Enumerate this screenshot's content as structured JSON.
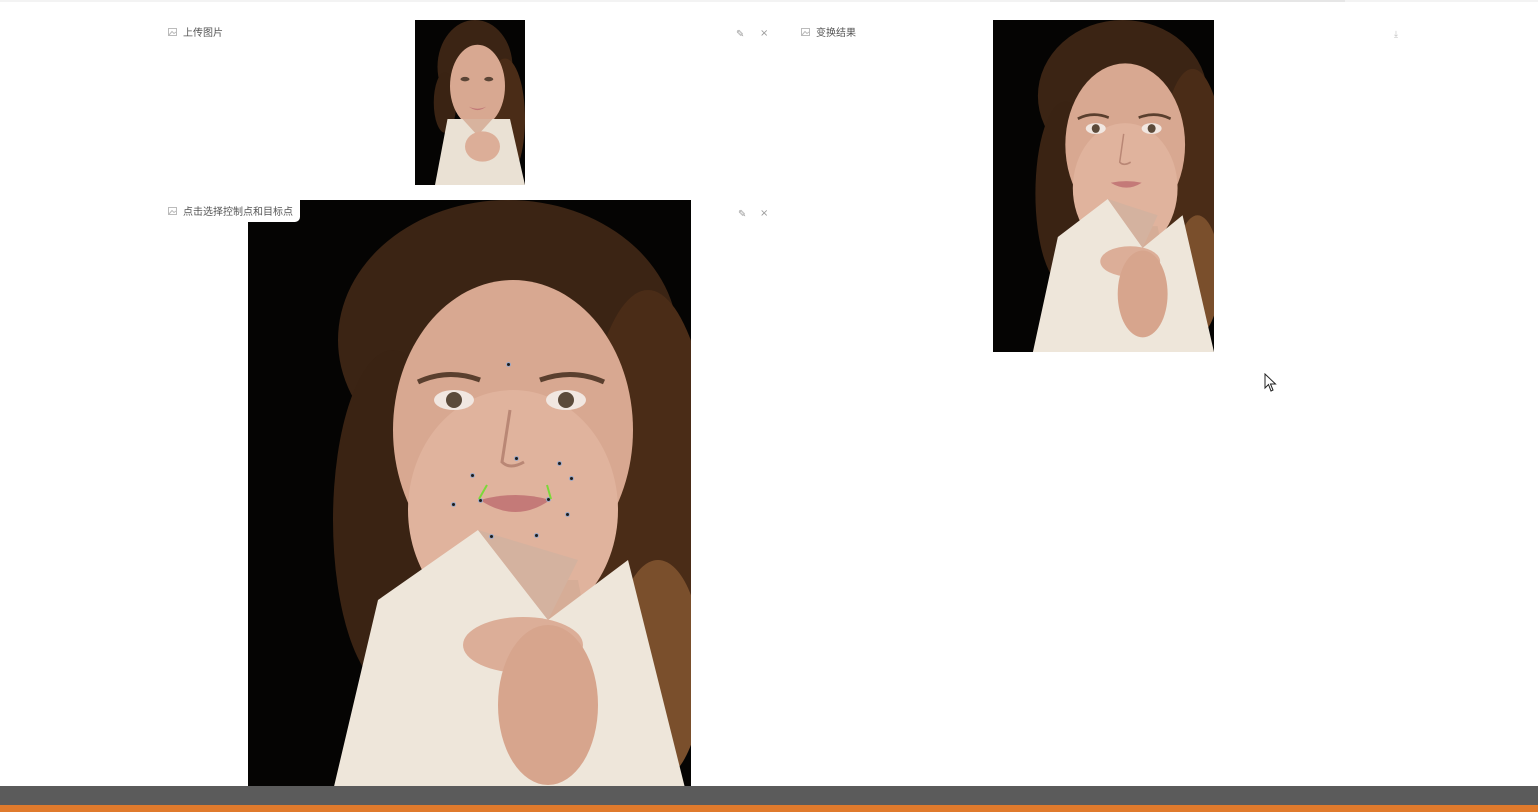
{
  "panels": {
    "upload": {
      "label": "上传图片",
      "icon": "image-icon",
      "tools": [
        "edit-icon",
        "close-icon"
      ]
    },
    "select_points": {
      "label": "点击选择控制点和目标点",
      "icon": "image-icon",
      "tools": [
        "edit-icon",
        "close-icon"
      ]
    },
    "result": {
      "label": "变换结果",
      "icon": "image-icon",
      "tools": [
        "download-icon"
      ]
    }
  },
  "glyphs": {
    "edit": "✎",
    "close": "×",
    "download": "⤓"
  },
  "colors": {
    "accent": "#e07a2c",
    "bottom_bar": "#5b5b5b",
    "selected_point": "#7cd83a",
    "image_background": "#050403"
  }
}
